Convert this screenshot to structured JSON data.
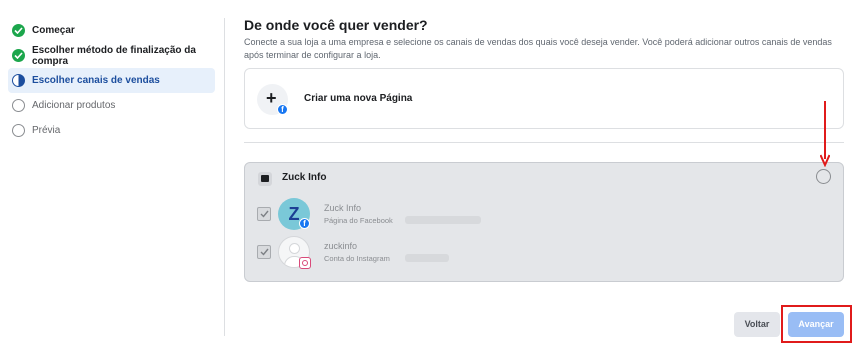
{
  "sidebar": {
    "steps": [
      {
        "label": "Começar",
        "state": "done"
      },
      {
        "label": "Escolher método de finalização da compra",
        "state": "done"
      },
      {
        "label": "Escolher canais de vendas",
        "state": "active"
      },
      {
        "label": "Adicionar produtos",
        "state": "todo"
      },
      {
        "label": "Prévia",
        "state": "todo"
      }
    ]
  },
  "main": {
    "title": "De onde você quer vender?",
    "description": "Conecte a sua loja a uma empresa e selecione os canais de vendas dos quais você deseja vender. Você poderá adicionar outros canais de vendas após terminar de configurar a loja.",
    "create_page_label": "Criar uma nova Página",
    "business": {
      "name": "Zuck Info",
      "assets": [
        {
          "avatar_letter": "Z",
          "name": "Zuck Info",
          "subtitle": "Página do Facebook",
          "badge": "facebook-icon"
        },
        {
          "name": "zuckinfo",
          "subtitle": "Conta do Instagram",
          "badge": "instagram-icon"
        }
      ]
    }
  },
  "footer": {
    "back_label": "Voltar",
    "next_label": "Avançar"
  },
  "colors": {
    "accent": "#1877f2",
    "done": "#1ca64c",
    "annotation": "#e01b1b"
  }
}
